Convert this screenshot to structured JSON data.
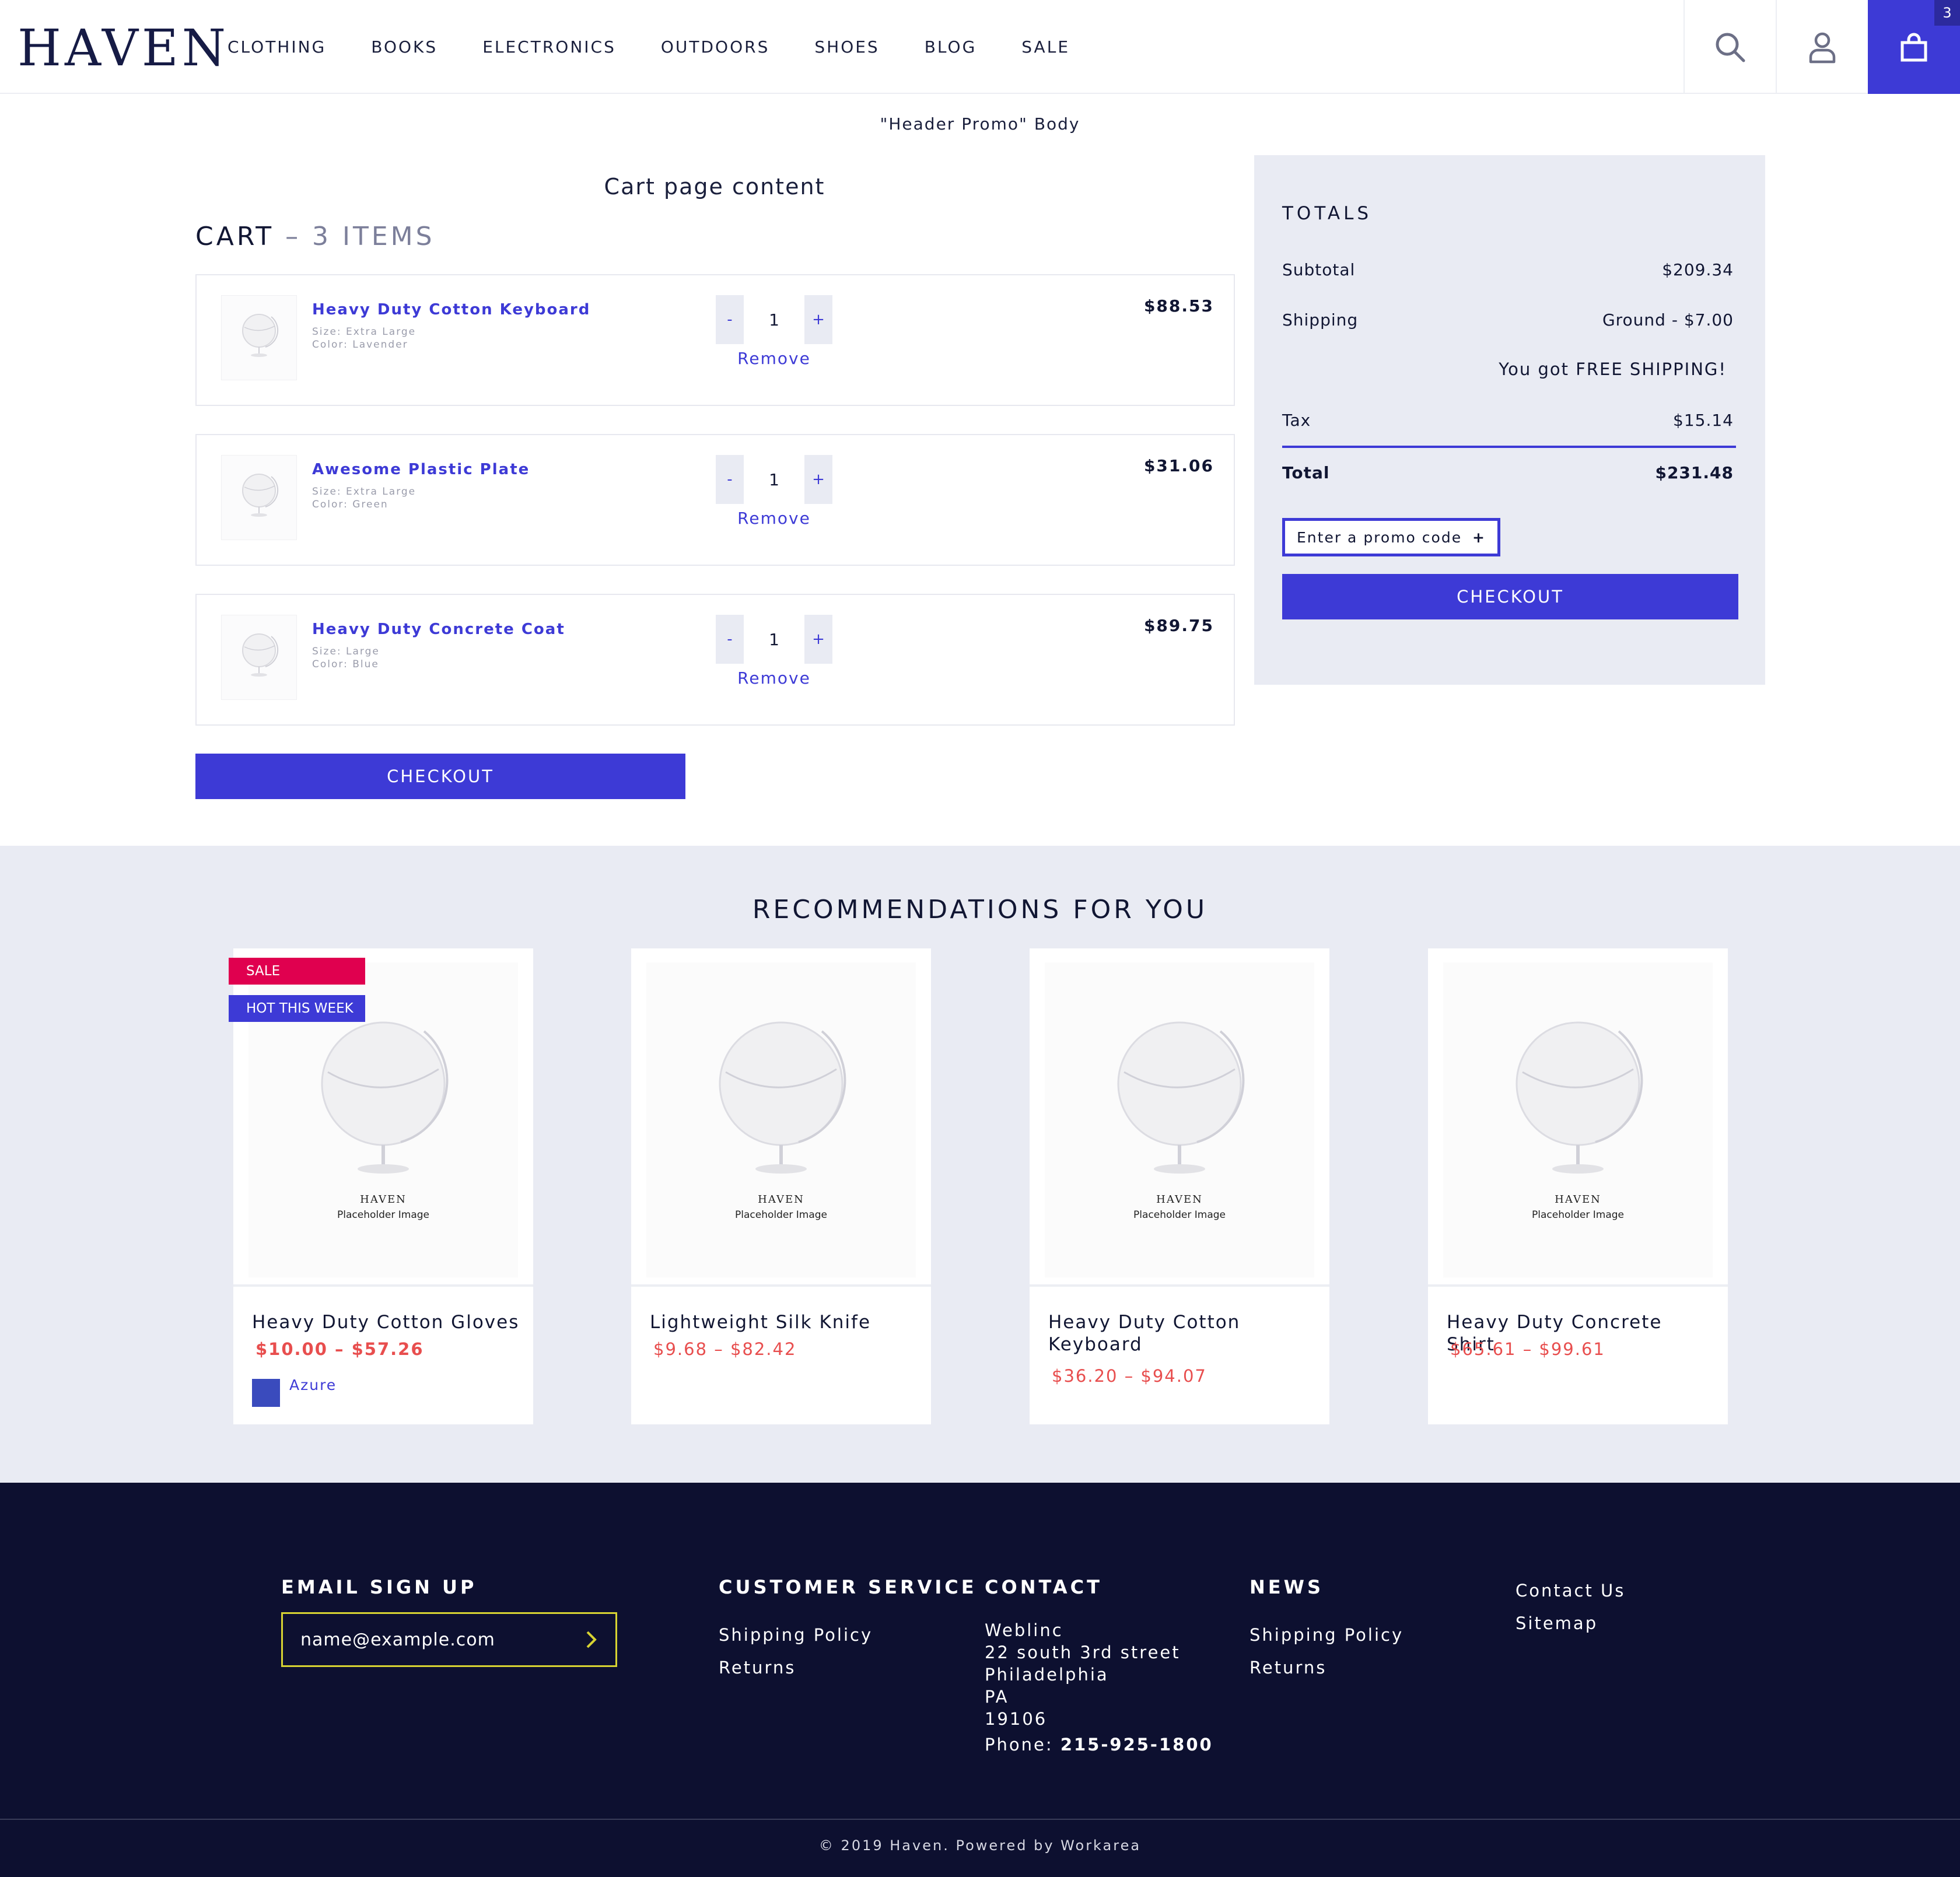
{
  "header": {
    "logo": "HAVEN",
    "nav": [
      "CLOTHING",
      "BOOKS",
      "ELECTRONICS",
      "OUTDOORS",
      "SHOES",
      "BLOG",
      "SALE"
    ],
    "icons": {
      "search": "search-icon",
      "account": "user-icon",
      "cart": "shopping-bag-icon"
    },
    "cart_count": "3"
  },
  "promo": {
    "body": "\"Header Promo\" Body"
  },
  "cart": {
    "content_title": "Cart page content",
    "heading": "CART",
    "items_count": " – 3 ITEMS",
    "items": [
      {
        "name": "Heavy Duty Cotton Keyboard",
        "size": "Size: Extra Large",
        "color": "Color: Lavender",
        "qty": "1",
        "price": "$88.53",
        "minus": "-",
        "plus": "+",
        "remove": "Remove"
      },
      {
        "name": "Awesome Plastic Plate",
        "size": "Size: Extra Large",
        "color": "Color: Green",
        "qty": "1",
        "price": "$31.06",
        "minus": "-",
        "plus": "+",
        "remove": "Remove"
      },
      {
        "name": "Heavy Duty Concrete Coat",
        "size": "Size: Large",
        "color": "Color: Blue",
        "qty": "1",
        "price": "$89.75",
        "minus": "-",
        "plus": "+",
        "remove": "Remove"
      }
    ],
    "checkout_label": "CHECKOUT"
  },
  "totals": {
    "title": "TOTALS",
    "subtotal_label": "Subtotal",
    "subtotal_value": "$209.34",
    "shipping_label": "Shipping",
    "shipping_value": "Ground - $7.00",
    "free_shipping": "You got FREE SHIPPING!",
    "tax_label": "Tax",
    "tax_value": "$15.14",
    "total_label": "Total",
    "total_value": "$231.48",
    "promo_placeholder": "Enter a promo code",
    "promo_plus": "+",
    "checkout_label": "CHECKOUT"
  },
  "recommendations": {
    "title": "RECOMMENDATIONS FOR YOU",
    "placeholder_brand": "HAVEN",
    "placeholder_caption": "Placeholder Image",
    "products": [
      {
        "name": "Heavy Duty Cotton Gloves",
        "price": "$10.00 – $57.26",
        "badges": [
          "SALE",
          "HOT THIS WEEK"
        ],
        "swatch_label": "Azure"
      },
      {
        "name": "Lightweight Silk Knife",
        "price": "$9.68 – $82.42"
      },
      {
        "name": "Heavy Duty Cotton Keyboard",
        "price": "$36.20 – $94.07"
      },
      {
        "name": "Heavy Duty Concrete Shirt",
        "price": "$65.61 – $99.61"
      }
    ],
    "colors": {
      "sale_badge": "#e0004f",
      "hot_badge": "#3d3ad6",
      "price": "#e84e4e",
      "swatch_azure": "#3a4bbd"
    }
  },
  "footer": {
    "email": {
      "heading": "EMAIL SIGN UP",
      "placeholder": "name@example.com",
      "submit_icon": "chevron-right-icon"
    },
    "customer_service": {
      "heading": "CUSTOMER SERVICE",
      "links": [
        "Shipping Policy",
        "Returns"
      ]
    },
    "contact": {
      "heading": "CONTACT",
      "lines": [
        "Weblinc",
        "22 south 3rd street",
        "Philadelphia",
        "PA",
        "19106"
      ],
      "phone_label": "Phone: ",
      "phone": "215-925-1800"
    },
    "news": {
      "heading": "NEWS",
      "links": [
        "Shipping Policy",
        "Returns"
      ]
    },
    "extra_links": [
      "Contact Us",
      "Sitemap"
    ],
    "copyright": "© 2019 Haven. Powered by Workarea"
  },
  "theme": {
    "accent": "#3d3ad6",
    "panel_bg": "#e9ebf3",
    "footer_bg": "#0d1030",
    "email_border": "#d7d332"
  }
}
